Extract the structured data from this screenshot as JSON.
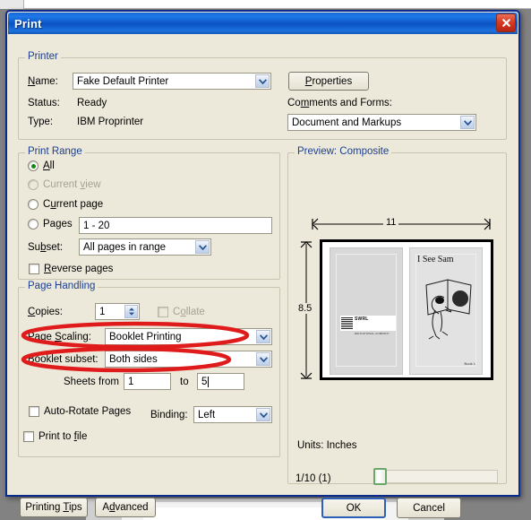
{
  "window": {
    "title": "Print",
    "close_icon": "close-x-icon"
  },
  "printer": {
    "legend": "Printer",
    "name_label": "Name:",
    "name_value": "Fake Default Printer",
    "status_label": "Status:",
    "status_value": "Ready",
    "type_label": "Type:",
    "type_value": "IBM Proprinter",
    "properties_button": "Properties",
    "comments_label": "Comments and Forms:",
    "comments_value": "Document and Markups"
  },
  "print_range": {
    "legend": "Print Range",
    "options": [
      {
        "label": "All",
        "selected": true,
        "disabled": false
      },
      {
        "label": "Current view",
        "selected": false,
        "disabled": true
      },
      {
        "label": "Current page",
        "selected": false,
        "disabled": false
      },
      {
        "label": "Pages",
        "selected": false,
        "disabled": false
      }
    ],
    "pages_value": "1 - 20",
    "subset_label": "Subset:",
    "subset_value": "All pages in range",
    "reverse_label": "Reverse pages",
    "reverse_checked": false
  },
  "page_handling": {
    "legend": "Page Handling",
    "copies_label": "Copies:",
    "copies_value": "1",
    "collate_label": "Collate",
    "collate_checked": false,
    "collate_disabled": true,
    "page_scaling_label": "Page Scaling:",
    "page_scaling_value": "Booklet Printing",
    "booklet_subset_label": "Booklet subset:",
    "booklet_subset_value": "Both sides",
    "sheets_from_label": "Sheets from",
    "sheets_from_value": "1",
    "sheets_to_label": "to",
    "sheets_to_value": "5",
    "auto_rotate_label": "Auto-Rotate Pages",
    "auto_rotate_checked": false,
    "binding_label": "Binding:",
    "binding_value": "Left",
    "print_to_file_label": "Print to file",
    "print_to_file_checked": false
  },
  "preview": {
    "legend": "Preview: Composite",
    "width_dimension": "11",
    "height_dimension": "8.5",
    "units_label": "Units: Inches",
    "page_indicator": "1/10 (1)",
    "sheet_right_title": "I See Sam",
    "sheet_right_booknum": "Book 1",
    "sheet_left_logo_main": "SWRL",
    "sheet_left_logo_sub": "EDUCATIONAL COMPANY"
  },
  "footer": {
    "printing_tips": "Printing Tips",
    "advanced": "Advanced",
    "ok": "OK",
    "cancel": "Cancel"
  },
  "annotations": {
    "color": "#e01b1b",
    "ellipse_1_target": "page-scaling-row",
    "ellipse_2_target": "booklet-subset-row"
  }
}
